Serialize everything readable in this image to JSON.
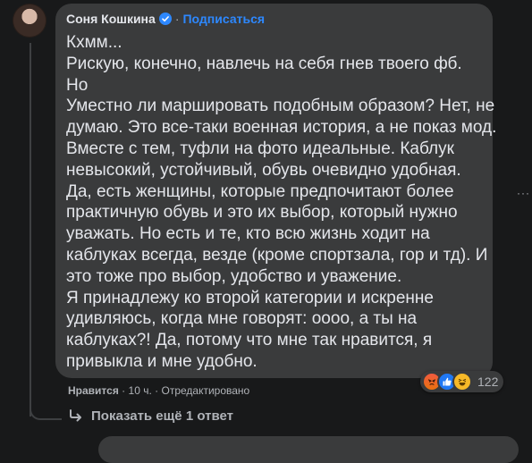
{
  "comment": {
    "author": "Соня Кошкина",
    "subscribe": "Подписаться",
    "separator": "·",
    "lines": [
      "Кхмм...",
      "Рискую, конечно, навлечь на себя гнев твоего фб.",
      "Но",
      "Уместно ли маршировать подобным образом? Нет, не",
      "думаю. Это все-таки военная история, а не показ мод.",
      "Вместе с тем, туфли на фото идеальные. Каблук",
      "невысокий, устойчивый, обувь очевидно удобная.",
      "Да, есть женщины, которые предпочитают более",
      "практичную обувь и это их выбор, который нужно",
      "уважать. Но есть и те, кто всю жизнь ходит на",
      "каблуках всегда, везде (кроме спортзала, гор и тд). И",
      "это тоже про выбор, удобство и уважение.",
      "Я принадлежу ко второй категории и искренне",
      "удивляюсь, когда мне говорят: оооо, а ты на",
      "каблуках?! Да, потому что мне так нравится, я",
      "привыкла и мне удобно."
    ],
    "reactions": {
      "icons": [
        "angry-icon",
        "like-icon",
        "haha-icon"
      ],
      "count": "122"
    },
    "actions": {
      "like": "Нравится",
      "time": "10 ч.",
      "edited": "Отредактировано",
      "separator": "·"
    }
  },
  "replies": {
    "show_more": "Показать ещё 1 ответ"
  },
  "colors": {
    "background": "#18191a",
    "bubble": "#3a3b3c",
    "text": "#e4e6eb",
    "secondary": "#b0b3b8",
    "link": "#2d88ff"
  }
}
